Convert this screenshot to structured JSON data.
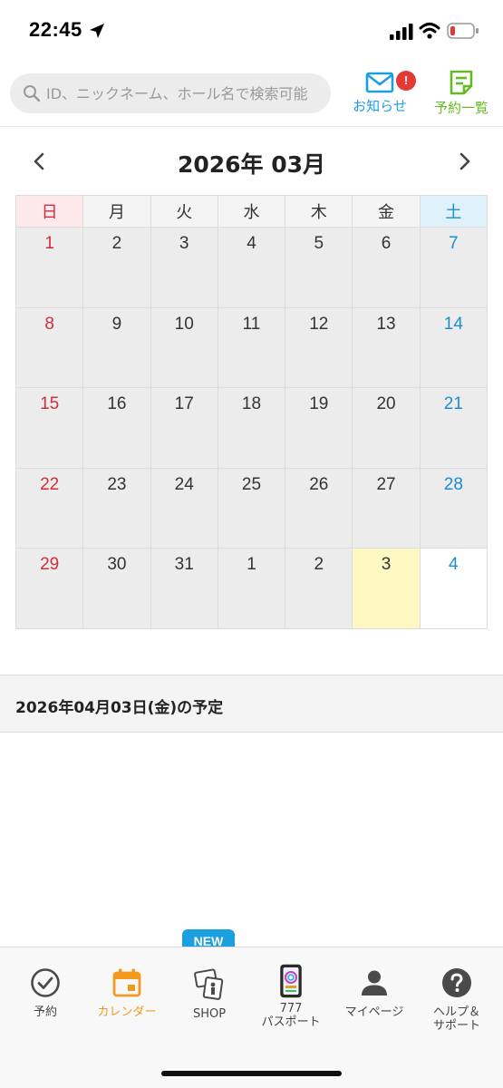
{
  "status_bar": {
    "time": "22:45",
    "icons": [
      "location-arrow-icon",
      "cellular-signal-icon",
      "wifi-icon",
      "battery-low-icon"
    ]
  },
  "header": {
    "search_placeholder": "ID、ニックネーム、ホール名で検索可能",
    "notice_label": "お知らせ",
    "notice_badge": "!",
    "reservations_label": "予約一覧",
    "colors": {
      "notice": "#1aa0e0",
      "reservations": "#66bb22",
      "badge": "#e53935"
    }
  },
  "calendar": {
    "title": "2026年 03月",
    "weekdays": [
      "日",
      "月",
      "火",
      "水",
      "木",
      "金",
      "土"
    ],
    "weeks": [
      [
        "1",
        "2",
        "3",
        "4",
        "5",
        "6",
        "7"
      ],
      [
        "8",
        "9",
        "10",
        "11",
        "12",
        "13",
        "14"
      ],
      [
        "15",
        "16",
        "17",
        "18",
        "19",
        "20",
        "21"
      ],
      [
        "22",
        "23",
        "24",
        "25",
        "26",
        "27",
        "28"
      ],
      [
        "29",
        "30",
        "31",
        "1",
        "2",
        "3",
        "4"
      ]
    ],
    "highlighted_day": "3",
    "colors": {
      "sunday": "#d42d3b",
      "saturday": "#1a8fd0",
      "highlight": "#fdf8c2"
    }
  },
  "schedule": {
    "title": "2026年04月03日(金)の予定"
  },
  "tabbar": {
    "new_badge": "NEW",
    "tabs": [
      {
        "label": "予約",
        "icon": "check-circle-icon"
      },
      {
        "label": "カレンダー",
        "icon": "calendar-icon",
        "active": true
      },
      {
        "label": "SHOP",
        "icon": "shop-cards-icon"
      },
      {
        "label": "777\nパスポート",
        "icon": "passport-card-icon"
      },
      {
        "label": "マイページ",
        "icon": "person-icon"
      },
      {
        "label": "ヘルプ＆\nサポート",
        "icon": "help-circle-icon"
      }
    ],
    "active_color": "#f39a1c"
  }
}
